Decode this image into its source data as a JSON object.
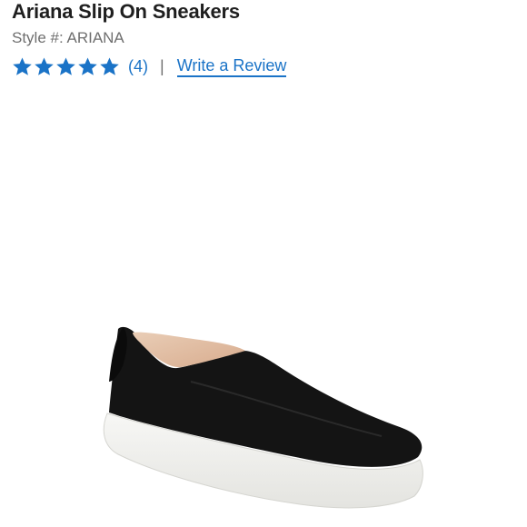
{
  "product": {
    "title": "Ariana Slip On Sneakers",
    "style_label": "Style #: ARIANA",
    "rating": 5,
    "rating_max": 5,
    "review_count": "(4)",
    "divider": "|",
    "write_review_label": "Write a Review"
  },
  "icons": {
    "star": "star-icon"
  },
  "colors": {
    "star": "#1a73c7",
    "link": "#1a73c7",
    "title": "#1f1f1f",
    "muted": "#6f6f6f"
  }
}
